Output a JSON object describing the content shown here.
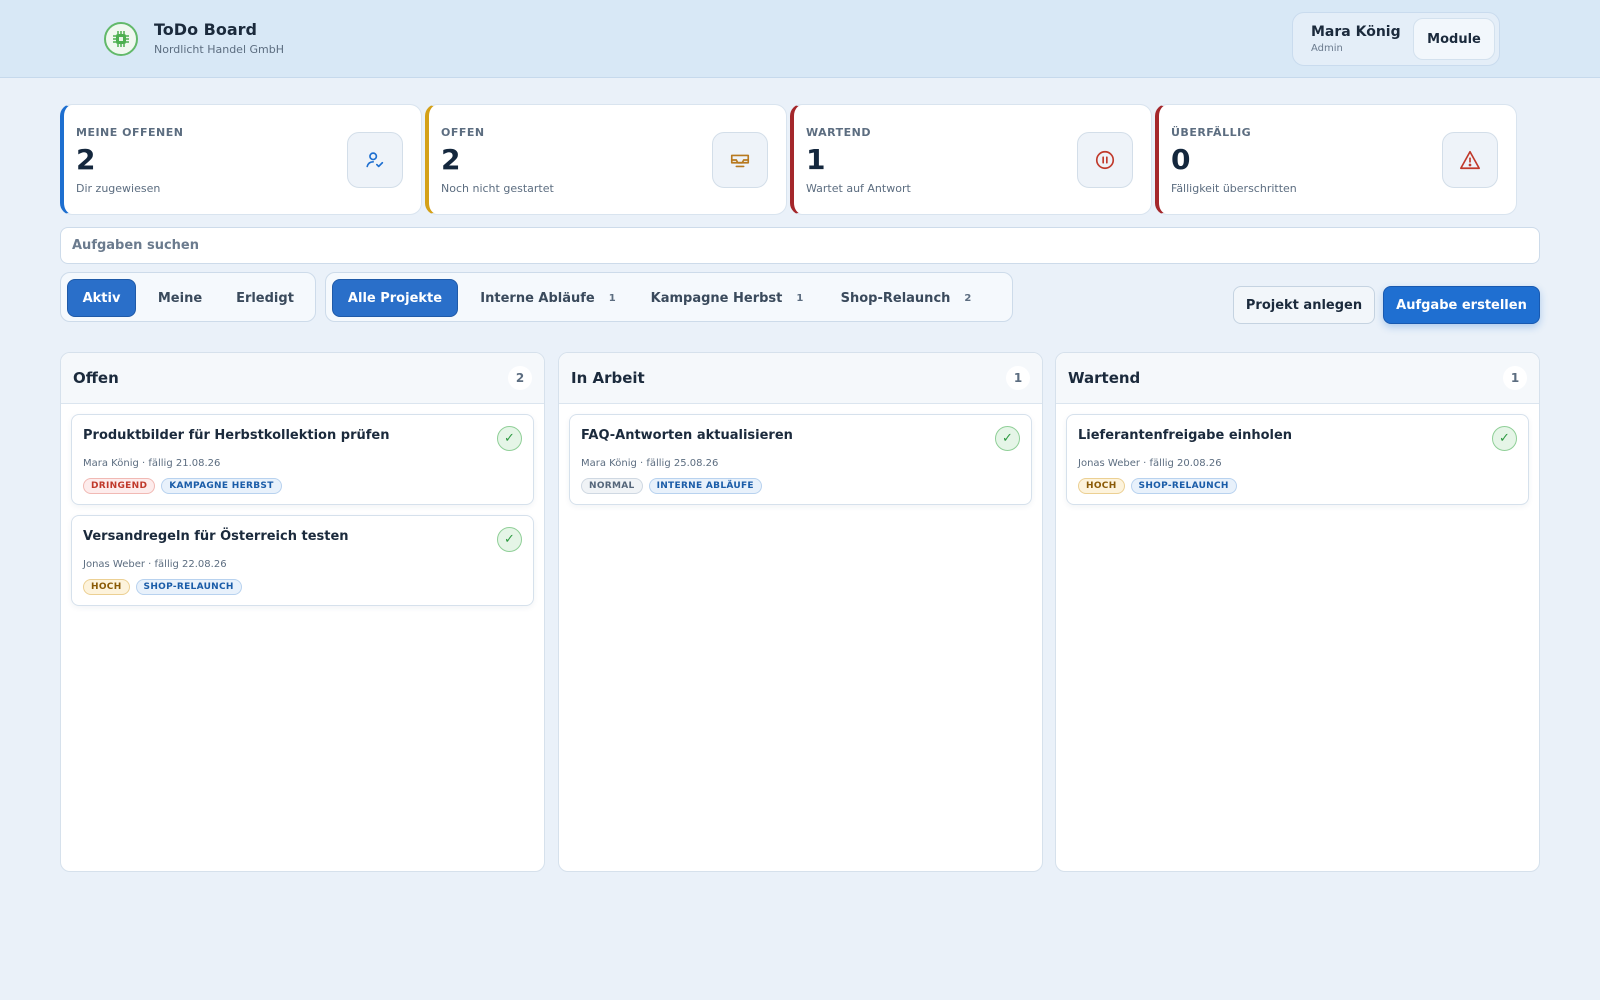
{
  "header": {
    "app_title": "ToDo Board",
    "company": "Nordlicht Handel GmbH",
    "user_name": "Mara König",
    "user_role": "Admin",
    "module_label": "Module"
  },
  "stats": [
    {
      "label": "MEINE OFFENEN",
      "value": "2",
      "sub": "Dir zugewiesen",
      "color": "#1e6fd0",
      "icon": "user-check-icon"
    },
    {
      "label": "OFFEN",
      "value": "2",
      "sub": "Noch nicht gestartet",
      "color": "#d4a017",
      "icon": "inbox-icon"
    },
    {
      "label": "WARTEND",
      "value": "1",
      "sub": "Wartet auf Antwort",
      "color": "#a4272b",
      "icon": "pause-icon"
    },
    {
      "label": "ÜBERFÄLLIG",
      "value": "0",
      "sub": "Fälligkeit überschritten",
      "color": "#a4272b",
      "icon": "warning-icon"
    }
  ],
  "search": {
    "placeholder": "Aufgaben suchen"
  },
  "status_filter": [
    {
      "label": "Aktiv",
      "active": true
    },
    {
      "label": "Meine",
      "active": false
    },
    {
      "label": "Erledigt",
      "active": false
    }
  ],
  "project_filter": [
    {
      "label": "Alle Projekte",
      "count": "",
      "active": true
    },
    {
      "label": "Interne Abläufe",
      "count": "1",
      "active": false
    },
    {
      "label": "Kampagne Herbst",
      "count": "1",
      "active": false
    },
    {
      "label": "Shop-Relaunch",
      "count": "2",
      "active": false
    }
  ],
  "actions": {
    "create_project": "Projekt anlegen",
    "create_task": "Aufgabe erstellen"
  },
  "columns": [
    {
      "title": "Offen",
      "count": "2",
      "cards": [
        {
          "title": "Produktbilder für Herbstkollektion prüfen",
          "meta": "Mara König · fällig 21.08.26",
          "priority": "DRINGEND",
          "project": "KAMPAGNE HERBST"
        },
        {
          "title": "Versandregeln für Österreich testen",
          "meta": "Jonas Weber · fällig 22.08.26",
          "priority": "HOCH",
          "project": "SHOP-RELAUNCH"
        }
      ]
    },
    {
      "title": "In Arbeit",
      "count": "1",
      "cards": [
        {
          "title": "FAQ-Antworten aktualisieren",
          "meta": "Mara König · fällig 25.08.26",
          "priority": "NORMAL",
          "project": "INTERNE ABLÄUFE"
        }
      ]
    },
    {
      "title": "Wartend",
      "count": "1",
      "cards": [
        {
          "title": "Lieferantenfreigabe einholen",
          "meta": "Jonas Weber · fällig 20.08.26",
          "priority": "HOCH",
          "project": "SHOP-RELAUNCH"
        }
      ]
    }
  ],
  "check_glyph": "✓"
}
